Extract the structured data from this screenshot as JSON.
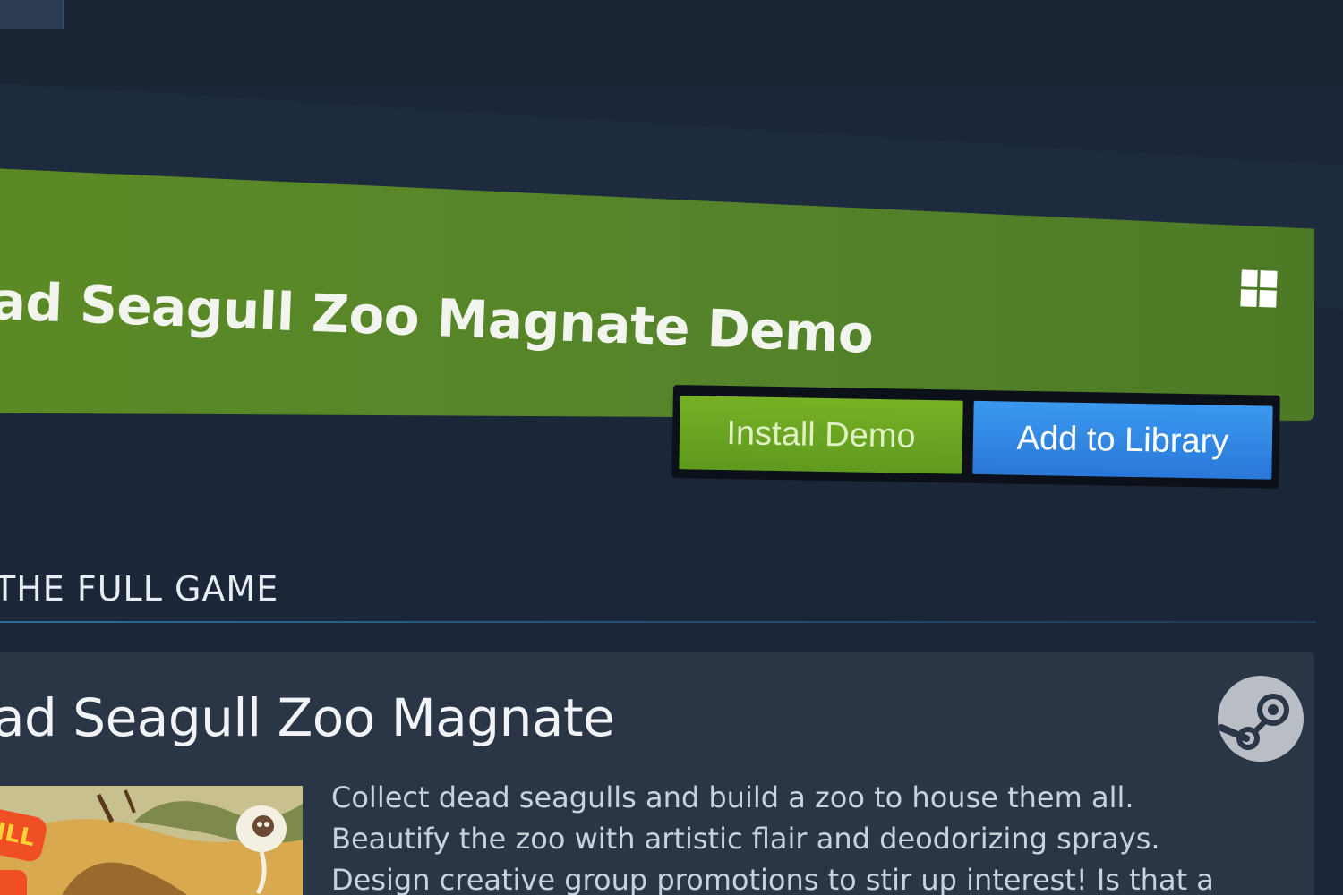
{
  "demo": {
    "title": "ad Seagull Zoo Magnate Demo",
    "platform_icon": "windows-icon",
    "install_label": "Install Demo",
    "library_label": "Add to Library"
  },
  "full_game": {
    "section_label": "THE FULL GAME",
    "title": "ad Seagull Zoo Magnate",
    "store_icon": "steam-icon",
    "description_lines": [
      "Collect dead seagulls and build a zoo to house them all.",
      "Beautify the zoo with artistic flair and deodorizing sprays.",
      "Design creative group promotions to stir up interest! Is that a"
    ],
    "capsule_badge": "ILL"
  },
  "colors": {
    "banner_green": "#5b8a25",
    "install_green": "#78b024",
    "library_blue": "#3a98ee",
    "background": "#1b2638",
    "card": "#2a3546"
  }
}
